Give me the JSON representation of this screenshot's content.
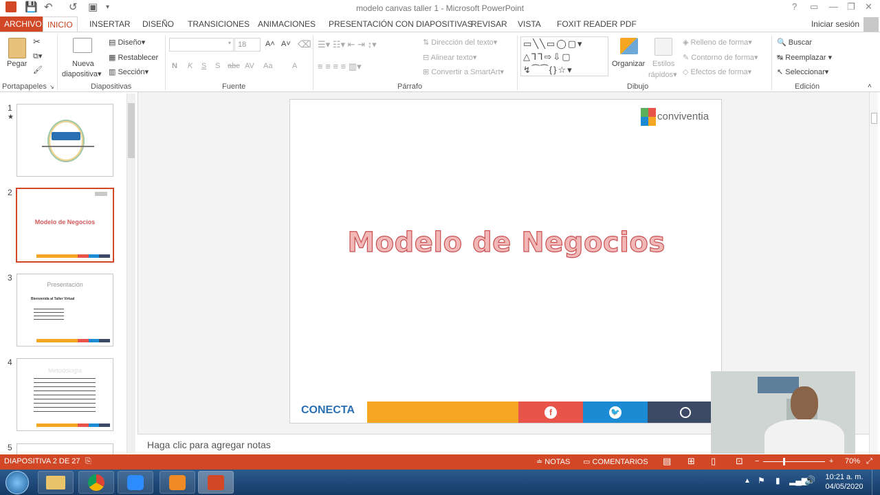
{
  "window": {
    "title": "modelo canvas taller 1 - Microsoft PowerPoint",
    "help": "?"
  },
  "tabs": [
    "ARCHIVO",
    "INICIO",
    "INSERTAR",
    "DISEÑO",
    "TRANSICIONES",
    "ANIMACIONES",
    "PRESENTACIÓN CON DIAPOSITIVAS",
    "REVISAR",
    "VISTA",
    "FOXIT READER PDF"
  ],
  "signin": "Iniciar sesión",
  "ribbon": {
    "portapapeles": {
      "label": "Portapapeles",
      "paste": "Pegar"
    },
    "diapositivas": {
      "label": "Diapositivas",
      "new_line1": "Nueva",
      "new_line2": "diapositiva",
      "layout": "Diseño",
      "reset": "Restablecer",
      "section": "Sección"
    },
    "fuente": {
      "label": "Fuente",
      "size": "18",
      "bold": "N",
      "italic": "K",
      "underline": "S",
      "shadow": "S",
      "strike": "abc",
      "spacing": "AV",
      "case": "Aa",
      "color": "A"
    },
    "parrafo": {
      "label": "Párrafo",
      "text_dir": "Dirección del texto",
      "align_text": "Alinear texto",
      "smartart": "Convertir a SmartArt"
    },
    "dibujo": {
      "label": "Dibujo",
      "arrange": "Organizar",
      "styles_line1": "Estilos",
      "styles_line2": "rápidos",
      "fill": "Relleno de forma",
      "outline": "Contorno de forma",
      "effects": "Efectos de forma"
    },
    "edicion": {
      "label": "Edición",
      "find": "Buscar",
      "replace": "Reemplazar",
      "select": "Seleccionar"
    }
  },
  "thumbnails": [
    {
      "num": "1",
      "star": "★"
    },
    {
      "num": "2",
      "title": "Modelo de Negocios"
    },
    {
      "num": "3",
      "title": "Presentación",
      "subtitle": "Bienvenida al Taller Virtual"
    },
    {
      "num": "4",
      "title": "Metodología"
    },
    {
      "num": "5"
    }
  ],
  "slide": {
    "title": "Modelo de Negocios",
    "brand": "conviventia",
    "footer_brand": "CONECTA"
  },
  "notes": {
    "placeholder": "Haga clic para agregar notas"
  },
  "status": {
    "slide": "DIAPOSITIVA 2 DE 27",
    "notes": "NOTAS",
    "comments": "COMENTARIOS",
    "zoom": "70%"
  },
  "clock": {
    "time": "10:21 a. m.",
    "date": "04/05/2020"
  },
  "colors": {
    "accent": "#d24726",
    "orange": "#f5a623",
    "red": "#e8534a",
    "twitter": "#1b8bd4",
    "navy": "#3d4a66"
  }
}
